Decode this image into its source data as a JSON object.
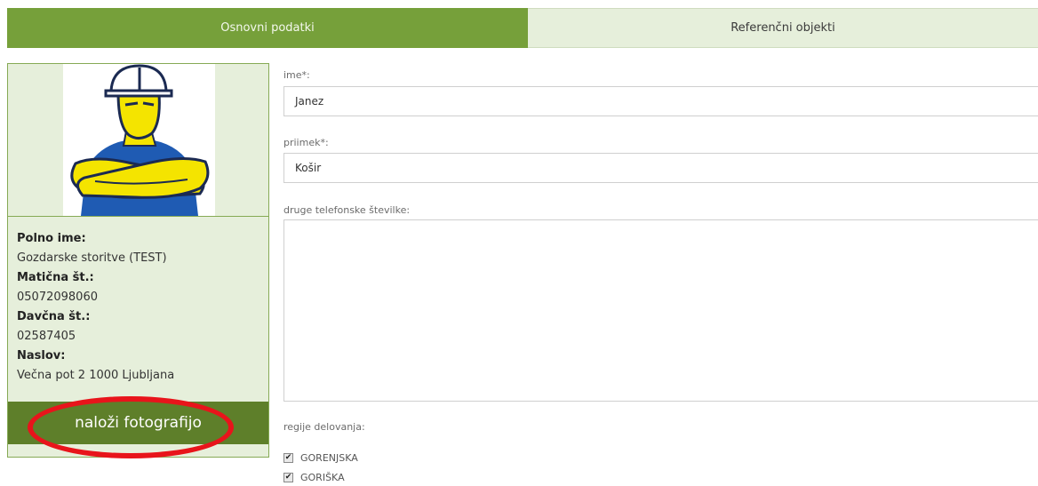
{
  "tabs": [
    {
      "label": "Osnovni podatki",
      "active": true
    },
    {
      "label": "Referenčni objekti",
      "active": false
    }
  ],
  "profile": {
    "photo_icon": "worker-avatar-icon",
    "full_name_label": "Polno ime:",
    "full_name": "Gozdarske storitve (TEST)",
    "reg_no_label": "Matična št.:",
    "reg_no": "05072098060",
    "tax_no_label": "Davčna št.:",
    "tax_no": "02587405",
    "address_label": "Naslov:",
    "address": "Večna pot 2 1000 Ljubljana",
    "upload_label": "naloži fotografijo"
  },
  "form": {
    "first_name_label": "ime*:",
    "first_name": "Janez",
    "last_name_label": "priimek*:",
    "last_name": "Košir",
    "phones_label": "druge telefonske številke:",
    "phones": "",
    "regions_label": "regije delovanja:",
    "regions": [
      {
        "label": "GORENJSKA",
        "checked": true
      },
      {
        "label": "GORIŠKA",
        "checked": true
      }
    ]
  },
  "colors": {
    "accent": "#76a03a",
    "accent_dark": "#5e7f2a",
    "panel": "#e6efdb",
    "annotation": "#e8141b"
  }
}
